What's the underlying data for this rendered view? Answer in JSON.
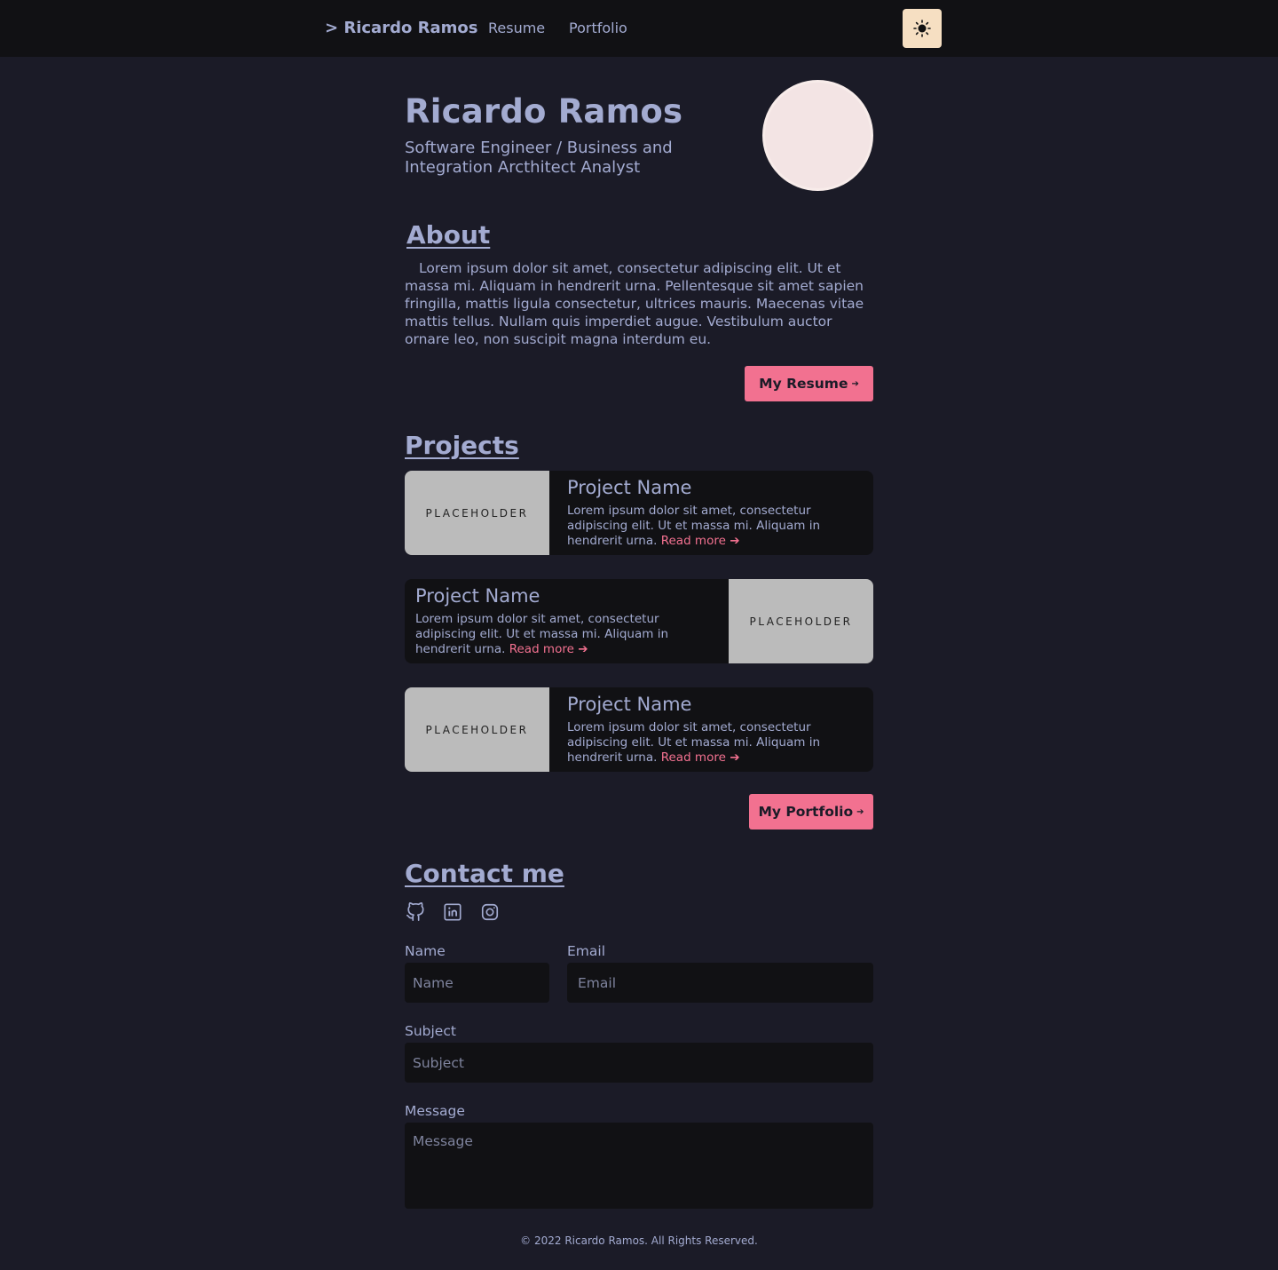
{
  "header": {
    "brand": "> Ricardo Ramos",
    "nav": [
      "Resume",
      "Portfolio"
    ],
    "theme_toggle_icon": "sun-icon"
  },
  "hero": {
    "name": "Ricardo Ramos",
    "subtitle": "Software Engineer / Business and Integration Arcthitect Analyst"
  },
  "about": {
    "title": "About",
    "text": "Lorem ipsum dolor sit amet, consectetur adipiscing elit. Ut et massa mi. Aliquam in hendrerit urna. Pellentesque sit amet sapien fringilla, mattis ligula consectetur, ultrices mauris. Maecenas vitae mattis tellus. Nullam quis imperdiet augue. Vestibulum auctor ornare leo, non suscipit magna interdum eu.",
    "button": "My Resume",
    "button_arrow": "➔"
  },
  "projects": {
    "title": "Projects",
    "items": [
      {
        "name": "Project Name",
        "thumb": "PLACEHOLDER",
        "desc": "Lorem ipsum dolor sit amet, consectetur adipiscing elit. Ut et massa mi. Aliquam in hendrerit urna.",
        "read_more": "Read more ➔"
      },
      {
        "name": "Project Name",
        "thumb": "PLACEHOLDER",
        "desc": "Lorem ipsum dolor sit amet, consectetur adipiscing elit. Ut et massa mi. Aliquam in hendrerit urna.",
        "read_more": "Read more ➔"
      },
      {
        "name": "Project Name",
        "thumb": "PLACEHOLDER",
        "desc": "Lorem ipsum dolor sit amet, consectetur adipiscing elit. Ut et massa mi. Aliquam in hendrerit urna.",
        "read_more": "Read more ➔"
      }
    ],
    "button": "My Portfolio",
    "button_arrow": "➔"
  },
  "contact": {
    "title": "Contact me",
    "socials": [
      "github-icon",
      "linkedin-icon",
      "instagram-icon"
    ],
    "form": {
      "name_label": "Name",
      "name_placeholder": "Name",
      "email_label": "Email",
      "email_placeholder": "Email",
      "subject_label": "Subject",
      "subject_placeholder": "Subject",
      "message_label": "Message",
      "message_placeholder": "Message"
    }
  },
  "footer": {
    "text": "© 2022 Ricardo Ramos. All Rights Reserved."
  },
  "colors": {
    "background": "#1b1b27",
    "panel": "#111114",
    "text": "#a3abd1",
    "accent": "#f27190",
    "toggle": "#f6dfc2"
  }
}
